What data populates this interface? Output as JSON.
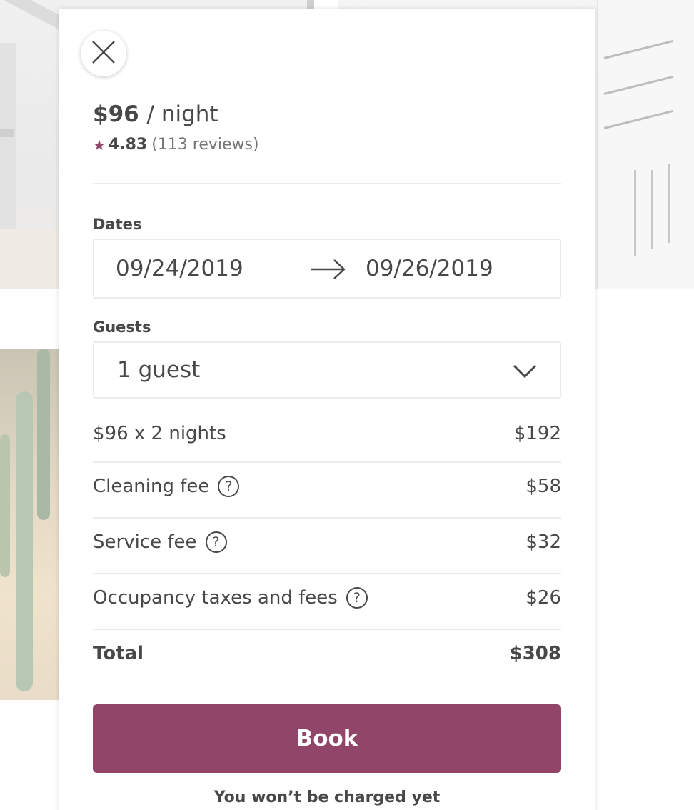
{
  "listing": {
    "price": "$96",
    "price_unit": "/ night",
    "rating": "4.83",
    "reviews": "(113 reviews)"
  },
  "dates": {
    "label": "Dates",
    "check_in": "09/24/2019",
    "check_out": "09/26/2019"
  },
  "guests": {
    "label": "Guests",
    "value": "1 guest"
  },
  "fees": [
    {
      "label": "$96 x 2 nights",
      "amount": "$192"
    },
    {
      "label": "Cleaning fee",
      "amount": "$58"
    },
    {
      "label": "Service fee",
      "amount": "$32"
    },
    {
      "label": "Occupancy taxes and fees",
      "amount": "$26"
    }
  ],
  "total": {
    "label": "Total",
    "amount": "$308"
  },
  "book": {
    "button_label": "Book",
    "note": "You won’t be charged yet"
  },
  "icons": {
    "close": "close-icon",
    "rating": "star-icon",
    "date_separator": "arrow-right-icon",
    "guests_dropdown": "chevron-down-icon",
    "fee_help": "question-circle-icon"
  },
  "colors": {
    "accent": "#914669",
    "text": "#484848",
    "muted": "#767676",
    "border": "#ebebeb"
  }
}
